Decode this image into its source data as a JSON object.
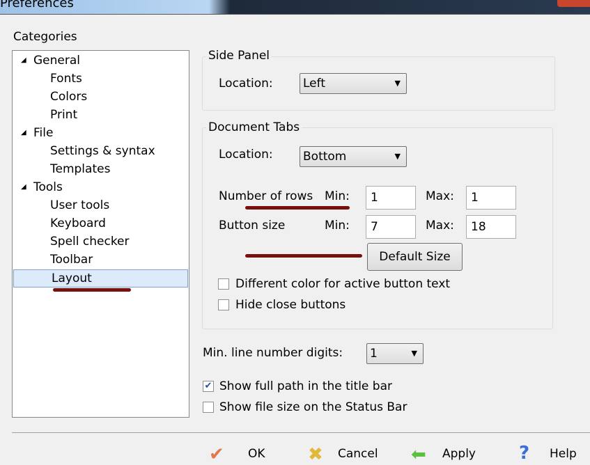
{
  "window": {
    "title": "Preferences"
  },
  "categories": {
    "label": "Categories",
    "items": [
      {
        "label": "General",
        "level": 0
      },
      {
        "label": "Fonts",
        "level": 1
      },
      {
        "label": "Colors",
        "level": 1
      },
      {
        "label": "Print",
        "level": 1
      },
      {
        "label": "File",
        "level": 0
      },
      {
        "label": "Settings & syntax",
        "level": 1
      },
      {
        "label": "Templates",
        "level": 1
      },
      {
        "label": "Tools",
        "level": 0
      },
      {
        "label": "User tools",
        "level": 1
      },
      {
        "label": "Keyboard",
        "level": 1
      },
      {
        "label": "Spell checker",
        "level": 1
      },
      {
        "label": "Toolbar",
        "level": 1
      },
      {
        "label": "Layout",
        "level": 1,
        "selected": true
      }
    ]
  },
  "side_panel": {
    "title": "Side Panel",
    "location_label": "Location:",
    "location_value": "Left"
  },
  "document_tabs": {
    "title": "Document Tabs",
    "location_label": "Location:",
    "location_value": "Bottom",
    "rows_label": "Number of rows",
    "button_size_label": "Button size",
    "min_label": "Min:",
    "max_label": "Max:",
    "rows_min": "1",
    "rows_max": "1",
    "size_min": "7",
    "size_max": "18",
    "default_size": "Default Size",
    "diff_color": "Different color for active button text",
    "diff_color_checked": false,
    "hide_close": "Hide close buttons",
    "hide_close_checked": false
  },
  "line_digits": {
    "label": "Min. line number digits:",
    "value": "1"
  },
  "show_full_path": {
    "label": "Show full path in the title bar",
    "checked": true
  },
  "show_file_size": {
    "label": "Show file size on the Status Bar",
    "checked": false
  },
  "buttons": {
    "ok": "OK",
    "cancel": "Cancel",
    "apply": "Apply",
    "help": "Help"
  },
  "colors": {
    "annotation": "#7a0f0f",
    "selection": "#dceafc"
  }
}
